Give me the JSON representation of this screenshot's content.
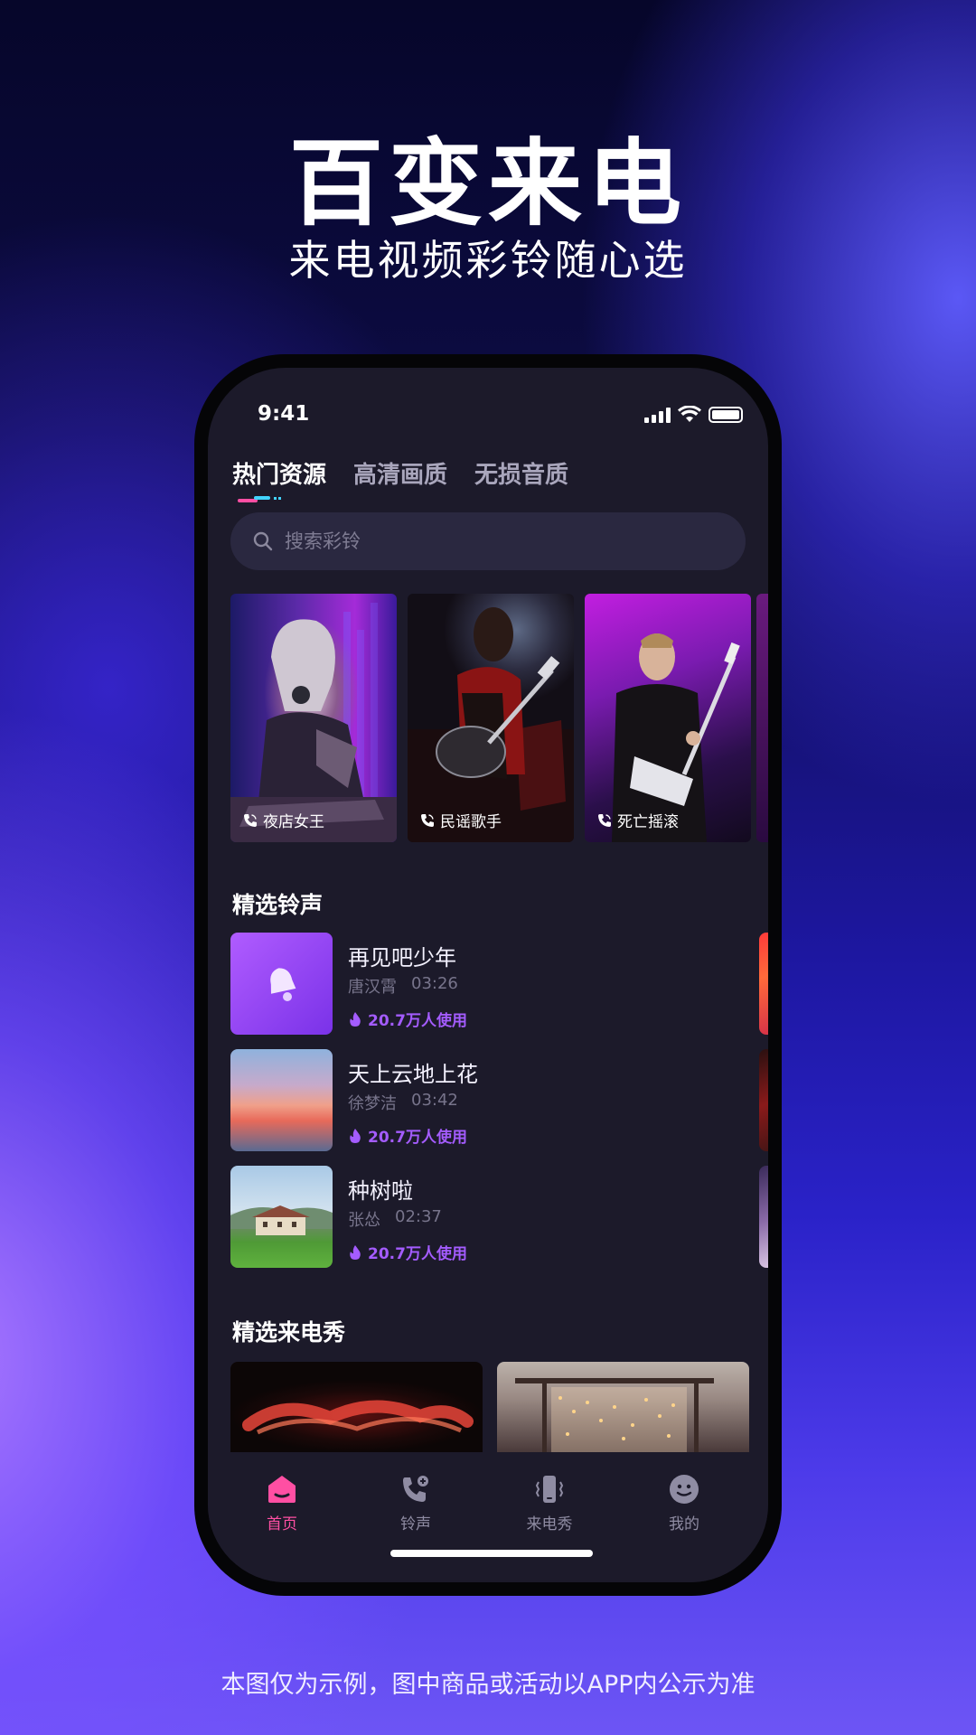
{
  "promo": {
    "headline": "百变来电",
    "subline": "来电视频彩铃随心选",
    "disclaimer": "本图仅为示例，图中商品或活动以APP内公示为准"
  },
  "status_bar": {
    "time": "9:41"
  },
  "tabs": [
    {
      "label": "热门资源",
      "active": true
    },
    {
      "label": "高清画质",
      "active": false
    },
    {
      "label": "无损音质",
      "active": false
    }
  ],
  "search": {
    "placeholder": "搜索彩铃"
  },
  "hot_cards": [
    {
      "caption": "夜店女王",
      "icon": "phone-call-icon"
    },
    {
      "caption": "民谣歌手",
      "icon": "phone-call-icon"
    },
    {
      "caption": "死亡摇滚",
      "icon": "phone-call-icon"
    }
  ],
  "ringtone_section": {
    "title": "精选铃声",
    "items": [
      {
        "name": "再见吧少年",
        "artist": "唐汉霄",
        "duration": "03:26",
        "uses": "20.7万人使用"
      },
      {
        "name": "天上云地上花",
        "artist": "徐梦洁",
        "duration": "03:42",
        "uses": "20.7万人使用"
      },
      {
        "name": "种树啦",
        "artist": "张怂",
        "duration": "02:37",
        "uses": "20.7万人使用"
      }
    ]
  },
  "show_section": {
    "title": "精选来电秀"
  },
  "bottom_nav": [
    {
      "label": "首页",
      "icon": "home-icon",
      "active": true
    },
    {
      "label": "铃声",
      "icon": "phone-music-icon",
      "active": false
    },
    {
      "label": "来电秀",
      "icon": "phone-vibrate-icon",
      "active": false
    },
    {
      "label": "我的",
      "icon": "smiley-icon",
      "active": false
    }
  ],
  "colors": {
    "accent_pink": "#ff4fa3",
    "accent_purple": "#a45cff",
    "screen_bg": "#1c1a2a"
  }
}
